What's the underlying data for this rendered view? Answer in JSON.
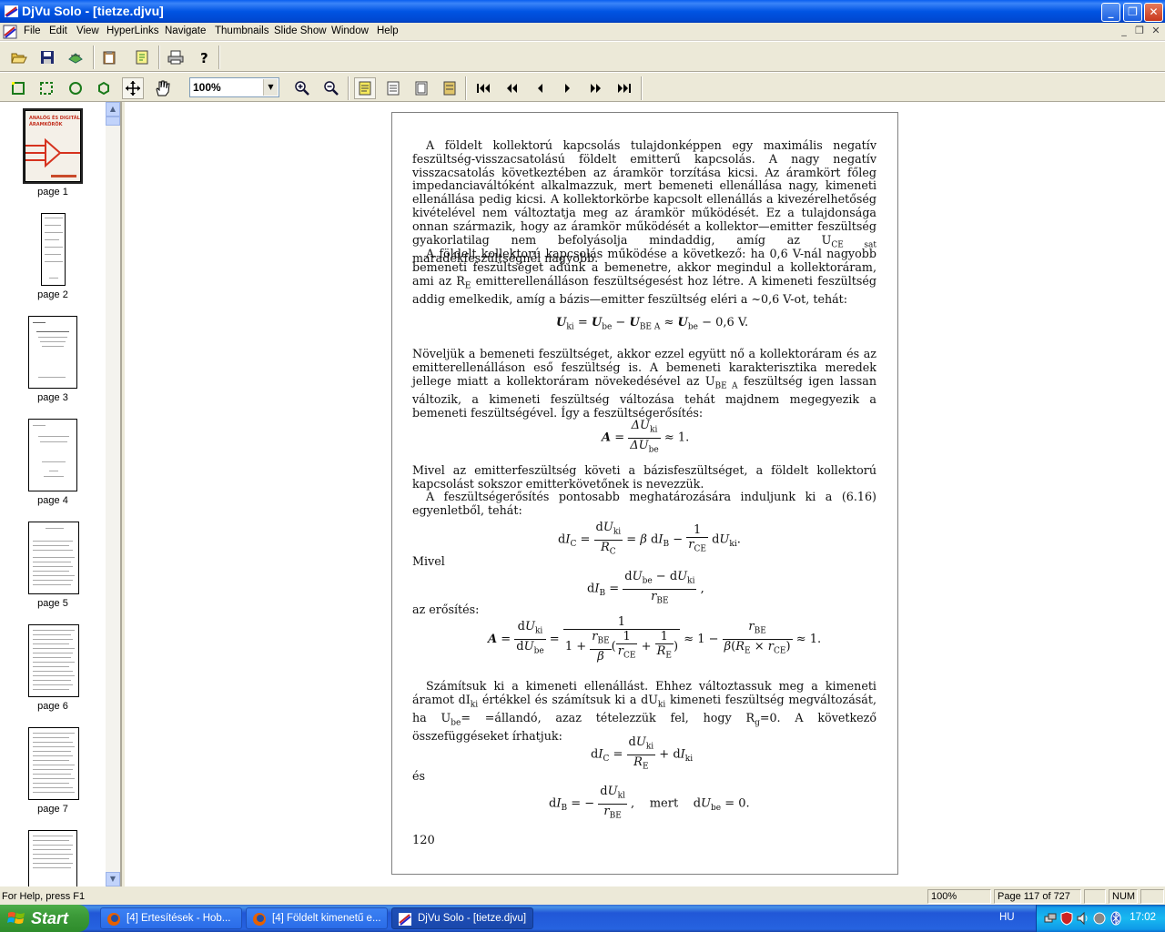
{
  "window": {
    "title": "DjVu Solo - [tietze.djvu]"
  },
  "menu": [
    "File",
    "Edit",
    "View",
    "HyperLinks",
    "Navigate",
    "Thumbnails",
    "Slide Show",
    "Window",
    "Help"
  ],
  "toolbar": {
    "zoom_value": "100%"
  },
  "thumbnails": [
    {
      "label": "page 1"
    },
    {
      "label": "page 2"
    },
    {
      "label": "page 3"
    },
    {
      "label": "page 4"
    },
    {
      "label": "page 5"
    },
    {
      "label": "page 6"
    },
    {
      "label": "page 7"
    }
  ],
  "thumb1_title": "ANALÓG ÉS DIGITÁLIS ÁRAMKÖRÖK",
  "document": {
    "p1": "A földelt kollektorú kapcsolás tulajdonképpen egy maximális negatív feszültség-visszacsatolású földelt emitterű kapcsolás. A nagy negatív visszacsatolás következtében az áramkör torzítása kicsi. Az áramkört főleg impedanciaváltóként alkalmazzuk, mert bemeneti ellenállása nagy, kimeneti ellenállása pedig kicsi. A kollektorkörbe kapcsolt ellenállás a kivezérelhetőség kivételével nem változtatja meg az áramkör működését. Ez a tulajdonsága onnan származik, hogy az áramkör működését a kollektor—emitter feszültség gyakorlatilag nem befolyásolja mindaddig, amíg az U",
    "p1_sub": "CE sat",
    "p1_end": " maradékfeszültségnél nagyobb.",
    "p2a": "A földelt kollektorú kapcsolás működése a következő: ha 0,6 V-nál nagyobb bemeneti feszültséget adunk a bemenetre, akkor megindul a kollektoráram, ami az R",
    "p2a_sub": "E",
    "p2b": " emitterellenálláson feszültségesést hoz létre. A kimeneti feszültség addig emelkedik, amíg a bázis—emitter feszültség eléri a ~0,6 V-ot, tehát:",
    "eq1": "U",
    "p3a": "Növeljük a bemeneti feszültséget, akkor ezzel együtt nő a kollektoráram és az emitterellenálláson eső feszültség is. A bemeneti karakterisztika meredek jellege miatt a kollektoráram növekedésével az U",
    "p3a_sub": "BE A",
    "p3b": " feszültség igen lassan változik, a kimeneti feszültség változása tehát majdnem megegyezik a bemeneti feszültségével. Így a feszültségerősítés:",
    "p4": "Mivel az emitterfeszültség követi a bázisfeszültséget, a földelt kollektorú kapcsolást sokszor emitterkövetőnek is nevezzük.",
    "p5": "A feszültségerősítés pontosabb meghatározására induljunk ki a (6.16) egyenletből, tehát:",
    "mivel": "Mivel",
    "az_erosites": "az erősítés:",
    "p6a": "Számítsuk ki a kimeneti ellenállást. Ehhez változtassuk meg a kimeneti áramot dI",
    "p6a_sub": "ki",
    "p6b": " értékkel és számítsuk ki a dU",
    "p6b_sub": "ki",
    "p6c": " kimeneti feszültség megváltozását, ha U",
    "p6c_sub": "be",
    "p6d": "= =állandó, azaz tételezzük fel, hogy R",
    "p6d_sub": "g",
    "p6e": "=0. A következő összefüggéseket írhatjuk:",
    "es": "és",
    "mert": "mert",
    "page_number": "120"
  },
  "status": {
    "help": "For Help, press F1",
    "zoom": "100%",
    "page": "Page 117 of 727",
    "num": "NUM"
  },
  "taskbar": {
    "start": "Start",
    "tasks": [
      "[4] Értesítések - Hob...",
      "[4] Földelt kimenetű e...",
      "DjVu Solo - [tietze.djvu]"
    ],
    "lang": "HU",
    "clock": "17:02"
  }
}
